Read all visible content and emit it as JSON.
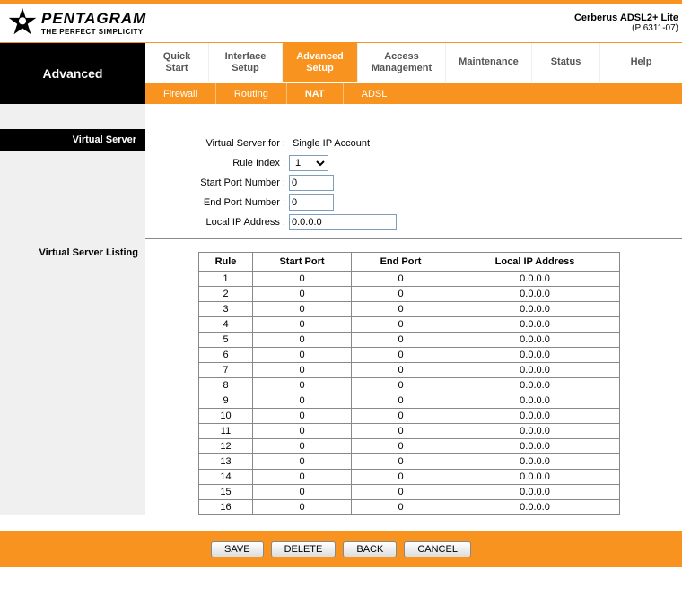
{
  "brand": {
    "name": "PENTAGRAM",
    "tagline": "THE PERFECT SIMPLICITY"
  },
  "device": {
    "name": "Cerberus ADSL2+ Lite",
    "model": "(P 6311-07)"
  },
  "nav": {
    "title": "Advanced",
    "tabs": [
      {
        "l1": "Quick",
        "l2": "Start"
      },
      {
        "l1": "Interface",
        "l2": "Setup"
      },
      {
        "l1": "Advanced",
        "l2": "Setup"
      },
      {
        "l1": "Access",
        "l2": "Management"
      },
      {
        "l1": "Maintenance",
        "l2": ""
      },
      {
        "l1": "Status",
        "l2": ""
      },
      {
        "l1": "Help",
        "l2": ""
      }
    ],
    "subtabs": [
      "Firewall",
      "Routing",
      "NAT",
      "ADSL"
    ]
  },
  "side": {
    "heading": "Virtual Server",
    "listing_label": "Virtual Server Listing"
  },
  "form": {
    "vs_for_label": "Virtual Server for :",
    "vs_for_value": "Single IP Account",
    "rule_index_label": "Rule Index :",
    "rule_index_value": "1",
    "start_port_label": "Start Port Number :",
    "start_port_value": "0",
    "end_port_label": "End Port Number :",
    "end_port_value": "0",
    "local_ip_label": "Local IP Address :",
    "local_ip_value": "0.0.0.0"
  },
  "table": {
    "headers": [
      "Rule",
      "Start Port",
      "End Port",
      "Local IP Address"
    ],
    "rows": [
      {
        "rule": "1",
        "start": "0",
        "end": "0",
        "ip": "0.0.0.0"
      },
      {
        "rule": "2",
        "start": "0",
        "end": "0",
        "ip": "0.0.0.0"
      },
      {
        "rule": "3",
        "start": "0",
        "end": "0",
        "ip": "0.0.0.0"
      },
      {
        "rule": "4",
        "start": "0",
        "end": "0",
        "ip": "0.0.0.0"
      },
      {
        "rule": "5",
        "start": "0",
        "end": "0",
        "ip": "0.0.0.0"
      },
      {
        "rule": "6",
        "start": "0",
        "end": "0",
        "ip": "0.0.0.0"
      },
      {
        "rule": "7",
        "start": "0",
        "end": "0",
        "ip": "0.0.0.0"
      },
      {
        "rule": "8",
        "start": "0",
        "end": "0",
        "ip": "0.0.0.0"
      },
      {
        "rule": "9",
        "start": "0",
        "end": "0",
        "ip": "0.0.0.0"
      },
      {
        "rule": "10",
        "start": "0",
        "end": "0",
        "ip": "0.0.0.0"
      },
      {
        "rule": "11",
        "start": "0",
        "end": "0",
        "ip": "0.0.0.0"
      },
      {
        "rule": "12",
        "start": "0",
        "end": "0",
        "ip": "0.0.0.0"
      },
      {
        "rule": "13",
        "start": "0",
        "end": "0",
        "ip": "0.0.0.0"
      },
      {
        "rule": "14",
        "start": "0",
        "end": "0",
        "ip": "0.0.0.0"
      },
      {
        "rule": "15",
        "start": "0",
        "end": "0",
        "ip": "0.0.0.0"
      },
      {
        "rule": "16",
        "start": "0",
        "end": "0",
        "ip": "0.0.0.0"
      }
    ]
  },
  "buttons": {
    "save": "SAVE",
    "delete": "DELETE",
    "back": "BACK",
    "cancel": "CANCEL"
  }
}
